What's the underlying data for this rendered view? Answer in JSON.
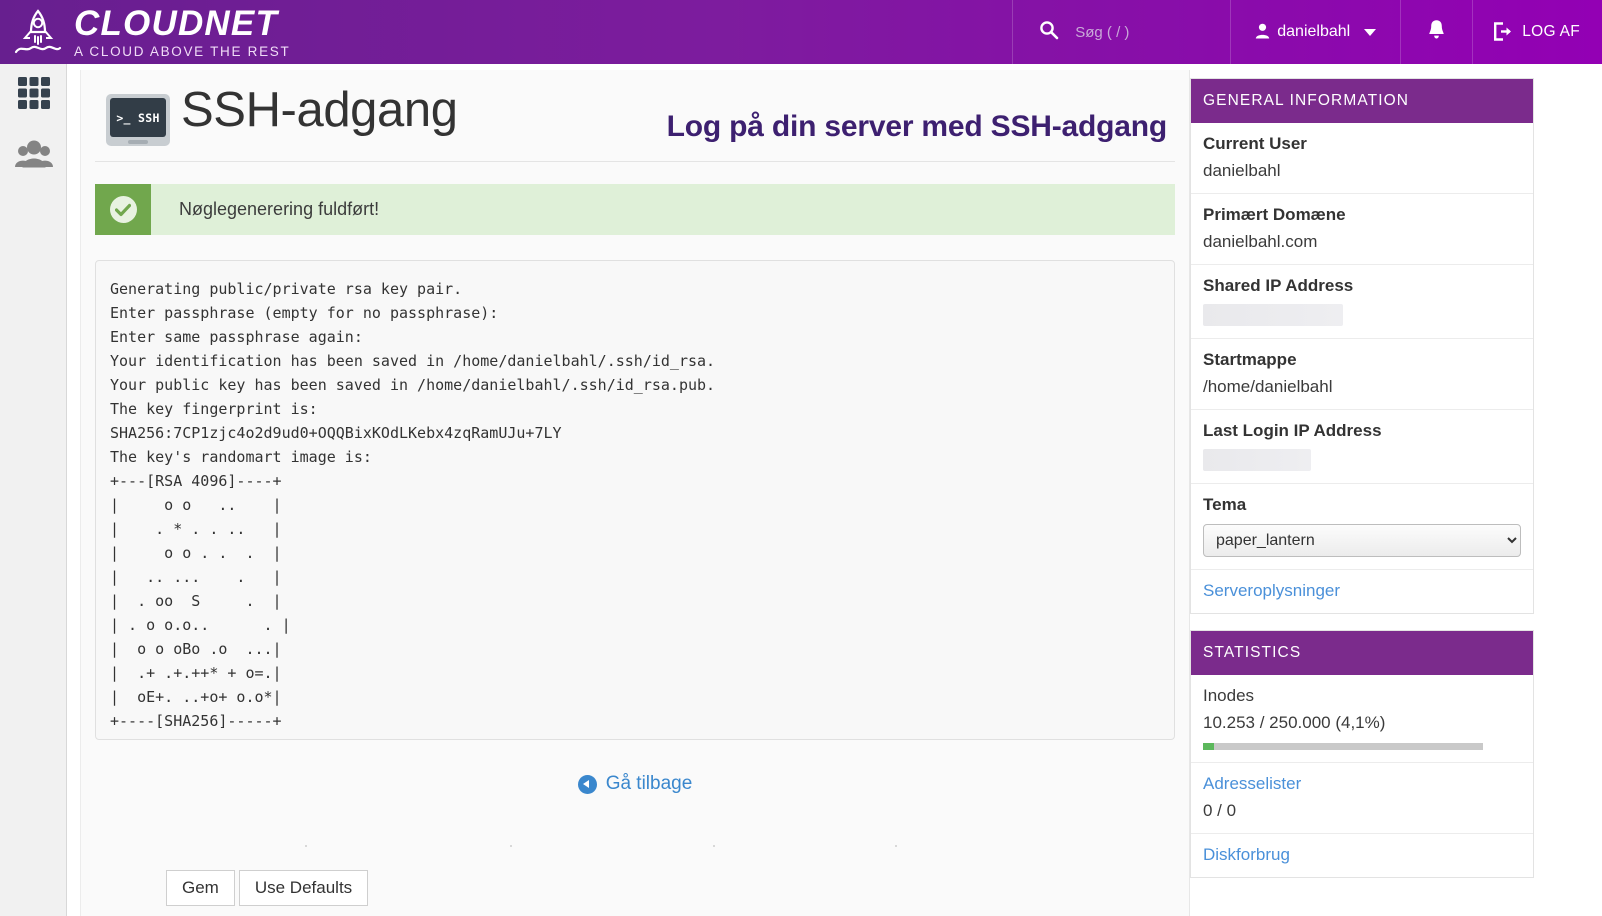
{
  "header": {
    "brand_name": "CLOUDNET",
    "brand_tagline": "A CLOUD ABOVE THE REST",
    "search_placeholder": "Søg ( / )",
    "username": "danielbahl",
    "logout_label": "LOG AF",
    "icons": {
      "rocket": "rocket-icon",
      "search": "search-icon",
      "user": "user-icon",
      "bell": "bell-icon",
      "logout": "logout-icon",
      "caret": "chevron-down-icon"
    },
    "colors": {
      "gradient_start": "#671f8f",
      "gradient_end": "#9300b4"
    }
  },
  "sidebar_rail": {
    "items": [
      {
        "name": "apps-grid",
        "icon": "grid-icon",
        "active": true
      },
      {
        "name": "users",
        "icon": "users-icon",
        "active": false
      }
    ]
  },
  "main": {
    "title": "SSH-adgang",
    "icon_label": ">_ SSH",
    "subtitle": "Log på din server med SSH-adgang",
    "alert": {
      "message": "Nøglegenerering fuldført!",
      "type": "success",
      "icon": "check-circle-icon",
      "band_color": "#71a74d",
      "bg_color": "#dff0d8"
    },
    "terminal_output": "Generating public/private rsa key pair.\nEnter passphrase (empty for no passphrase):\nEnter same passphrase again:\nYour identification has been saved in /home/danielbahl/.ssh/id_rsa.\nYour public key has been saved in /home/danielbahl/.ssh/id_rsa.pub.\nThe key fingerprint is:\nSHA256:7CP1zjc4o2d9ud0+OQQBixKOdLKebx4zqRamUJu+7LY\nThe key's randomart image is:\n+---[RSA 4096]----+\n|     o o   ..    |\n|    . * . . ..   |\n|     o o . .  .  |\n|   .. ...    .   |\n|  . oo  S     .  |\n| . o o.o..      . |\n|  o o oBo .o  ...|\n|  .+ .+.++* + o=.|\n|  oE+. ..+o+ o.o*|\n+----[SHA256]-----+",
    "back_link": "Gå tilbage",
    "buttons": [
      {
        "label": "Gem"
      },
      {
        "label": "Use Defaults"
      }
    ]
  },
  "general_information": {
    "heading": "GENERAL INFORMATION",
    "rows": [
      {
        "label": "Current User",
        "value": "danielbahl",
        "redacted": false
      },
      {
        "label": "Primært Domæne",
        "value": "danielbahl.com",
        "redacted": false
      },
      {
        "label": "Shared IP Address",
        "value": "",
        "redacted": true
      },
      {
        "label": "Startmappe",
        "value": "/home/danielbahl",
        "redacted": false
      },
      {
        "label": "Last Login IP Address",
        "value": "",
        "redacted": true
      }
    ],
    "theme_label": "Tema",
    "theme_value": "paper_lantern",
    "server_info_link": "Serveroplysninger"
  },
  "statistics": {
    "heading": "STATISTICS",
    "inodes_label": "Inodes",
    "inodes_value": "10.253 / 250.000   (4,1%)",
    "inodes_percent": 4.1,
    "addresslists_label": "Adresselister",
    "addresslists_value": "0 / 0",
    "disk_label": "Diskforbrug"
  }
}
